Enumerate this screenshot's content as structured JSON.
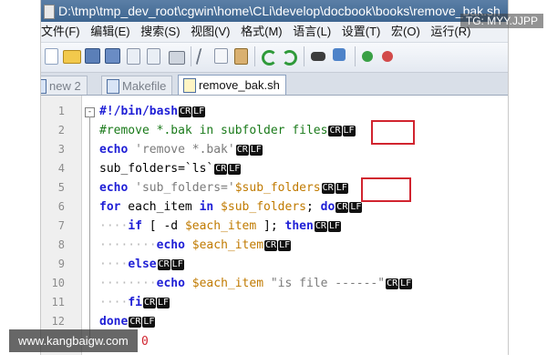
{
  "window": {
    "title": "D:\\tmp\\tmp_dev_root\\cgwin\\home\\CLi\\develop\\docbook\\books\\remove_bak.sh"
  },
  "watermark_top": "TG: MYY.JJPP",
  "watermark_site": "www.kangbaigw.com",
  "menu": [
    "文件(F)",
    "编辑(E)",
    "搜索(S)",
    "视图(V)",
    "格式(M)",
    "语言(L)",
    "设置(T)",
    "宏(O)",
    "运行(R)"
  ],
  "toolbar_icons": [
    "new-file-icon",
    "open-file-icon",
    "save-icon",
    "save-all-icon",
    "close-icon",
    "close-all-icon",
    "print-icon",
    "cut-icon",
    "copy-icon",
    "paste-icon",
    "undo-icon",
    "redo-icon",
    "find-icon",
    "replace-icon",
    "zoom-in-icon",
    "zoom-out-icon"
  ],
  "tabs": [
    {
      "label": "new  2",
      "active": false
    },
    {
      "label": "Makefile",
      "active": false
    },
    {
      "label": "remove_bak.sh",
      "active": true
    }
  ],
  "eol_cr": "CR",
  "eol_lf": "LF",
  "code": {
    "l1_text": "#!/bin/bash",
    "l2_text": "#remove *.bak in subfolder files",
    "l3_kw": "echo",
    "l3_str": " 'remove *.bak'",
    "l4_text": "sub_folders=`ls`",
    "l5_kw": "echo",
    "l5_str": " 'sub_folders='",
    "l5_var": "$sub_folders",
    "l6_kw1": "for",
    "l6_t1": " each_item ",
    "l6_kw2": "in",
    "l6_var": " $sub_folders",
    "l6_t2": "; ",
    "l6_kw3": "do",
    "l7_kw1": "if",
    "l7_t1": " [ -d ",
    "l7_var": "$each_item",
    "l7_t2": " ]; ",
    "l7_kw2": "then",
    "l8_kw": "echo",
    "l8_var": " $each_item",
    "l9_kw": "else",
    "l10_kw": "echo",
    "l10_var": " $each_item",
    "l10_str": " \"is file ------\"",
    "l11_kw": "fi",
    "l12_kw": "done",
    "l13_text": "0"
  },
  "line_numbers": [
    "1",
    "2",
    "3",
    "4",
    "5",
    "6",
    "7",
    "8",
    "9",
    "10",
    "11",
    "12"
  ]
}
